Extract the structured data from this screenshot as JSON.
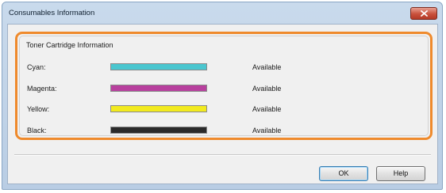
{
  "window": {
    "title": "Consumables Information"
  },
  "group": {
    "title": "Toner Cartridge Information"
  },
  "cartridges": [
    {
      "name": "Cyan:",
      "status": "Available",
      "color": "#4ac6cf",
      "level": 1.0
    },
    {
      "name": "Magenta:",
      "status": "Available",
      "color": "#b8409e",
      "level": 1.0
    },
    {
      "name": "Yellow:",
      "status": "Available",
      "color": "#f2ea1e",
      "level": 1.0
    },
    {
      "name": "Black:",
      "status": "Available",
      "color": "#2a2a2a",
      "level": 1.0
    }
  ],
  "buttons": {
    "ok": "OK",
    "help": "Help"
  },
  "colors": {
    "accent": "#ef8a2c",
    "close": "#c8513c"
  },
  "icons": {
    "close": "close-icon"
  }
}
